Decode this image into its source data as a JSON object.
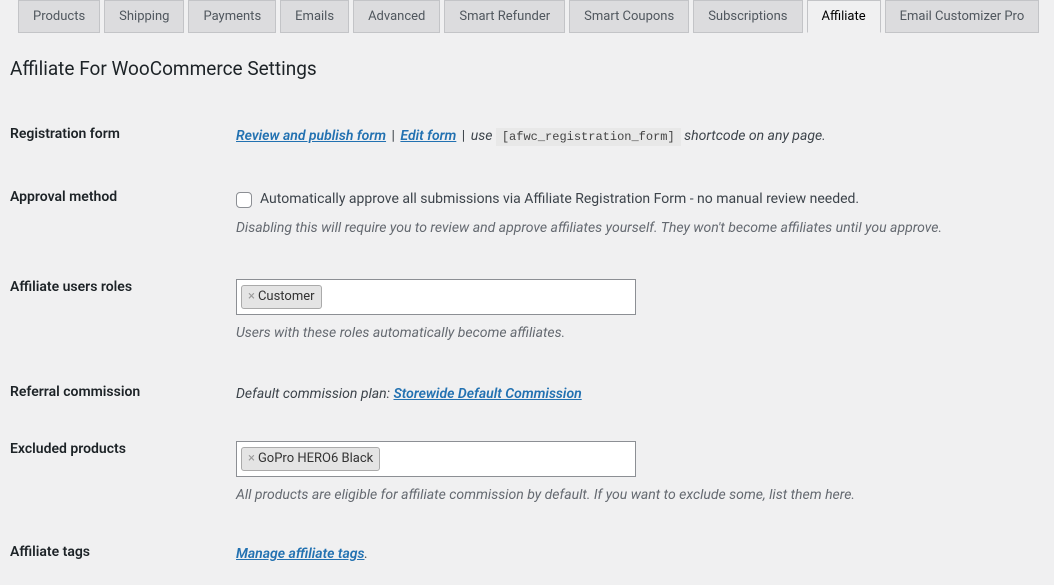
{
  "tabs": [
    {
      "label": "Products"
    },
    {
      "label": "Shipping"
    },
    {
      "label": "Payments"
    },
    {
      "label": "Emails"
    },
    {
      "label": "Advanced"
    },
    {
      "label": "Smart Refunder"
    },
    {
      "label": "Smart Coupons"
    },
    {
      "label": "Subscriptions"
    },
    {
      "label": "Affiliate",
      "active": true
    },
    {
      "label": "Email Customizer Pro"
    }
  ],
  "page_title": "Affiliate For WooCommerce Settings",
  "registration": {
    "label": "Registration form",
    "review_link": "Review and publish form",
    "pipe1": " | ",
    "edit_link": "Edit form",
    "pipe2": " | ",
    "use_text": "use ",
    "shortcode": "[afwc_registration_form]",
    "tail_text": " shortcode on any page."
  },
  "approval": {
    "label": "Approval method",
    "checkbox_label": "Automatically approve all submissions via Affiliate Registration Form - no manual review needed.",
    "description": "Disabling this will require you to review and approve affiliates yourself. They won't become affiliates until you approve."
  },
  "roles": {
    "label": "Affiliate users roles",
    "tokens": [
      "Customer"
    ],
    "description": "Users with these roles automatically become affiliates."
  },
  "referral": {
    "label": "Referral commission",
    "prefix": "Default commission plan: ",
    "link": "Storewide Default Commission"
  },
  "excluded": {
    "label": "Excluded products",
    "tokens": [
      "GoPro HERO6 Black"
    ],
    "description": "All products are eligible for affiliate commission by default. If you want to exclude some, list them here."
  },
  "tags": {
    "label": "Affiliate tags",
    "link": "Manage affiliate tags",
    "period": "."
  },
  "remove_glyph": "×"
}
